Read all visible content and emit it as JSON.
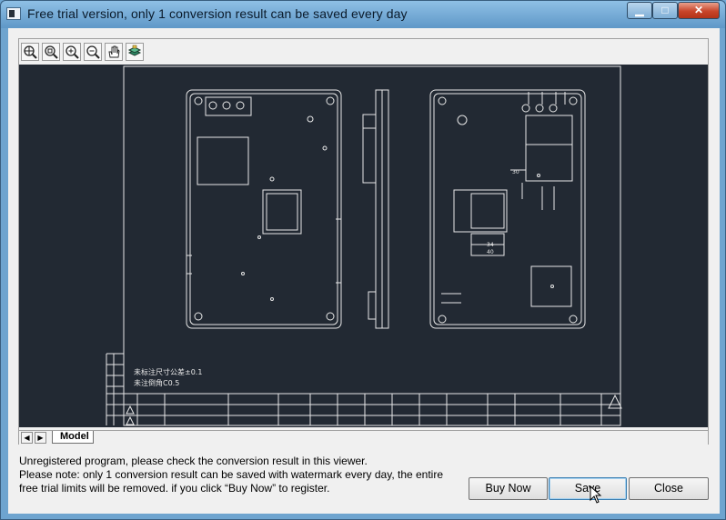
{
  "window": {
    "title": "Free trial version, only 1 conversion result can be saved every day",
    "minimize_glyph": "▁",
    "maximize_glyph": "□",
    "close_glyph": "✕"
  },
  "toolbar": {
    "buttons": [
      "zoom-extents-icon",
      "zoom-window-icon",
      "zoom-in-icon",
      "zoom-out-icon",
      "pan-hand-icon",
      "layers-icon"
    ]
  },
  "drawing": {
    "background": "#222933",
    "note_line1": "未标注尺寸公差±0.1",
    "note_line2": "未注倒角C0.5",
    "dim_a": "34",
    "dim_b": "40",
    "dim_c": "30"
  },
  "tabs": {
    "prev_label": "◀",
    "next_label": "▶",
    "active": "Model"
  },
  "message": {
    "line1": "Unregistered program, please check the conversion result in this viewer.",
    "line2": "Please note: only 1 conversion result can be saved with watermark every day, the entire",
    "line3": "free trial limits will be removed. if you click “Buy Now” to register."
  },
  "buttons": {
    "buy": "Buy Now",
    "save": "Save",
    "close": "Close"
  }
}
